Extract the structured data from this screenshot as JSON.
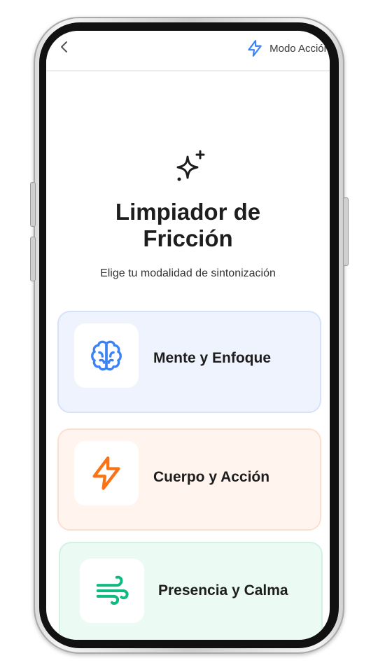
{
  "header": {
    "back_icon": "chevron-left-icon",
    "action_mode_label": "Modo Acción",
    "action_mode_icon": "lightning-icon"
  },
  "hero": {
    "icon": "sparkles-icon",
    "title_line1": "Limpiador de",
    "title_line2": "Fricción",
    "subtitle": "Elige tu modalidad de sintonización"
  },
  "modes": [
    {
      "label": "Mente y Enfoque",
      "icon": "brain-icon",
      "accent": "#3b82f6",
      "background": "#eef3fe"
    },
    {
      "label": "Cuerpo y Acción",
      "icon": "lightning-icon",
      "accent": "#f97316",
      "background": "#fff4ee"
    },
    {
      "label": "Presencia y Calma",
      "icon": "wind-icon",
      "accent": "#10b981",
      "background": "#ecfaf4"
    }
  ]
}
